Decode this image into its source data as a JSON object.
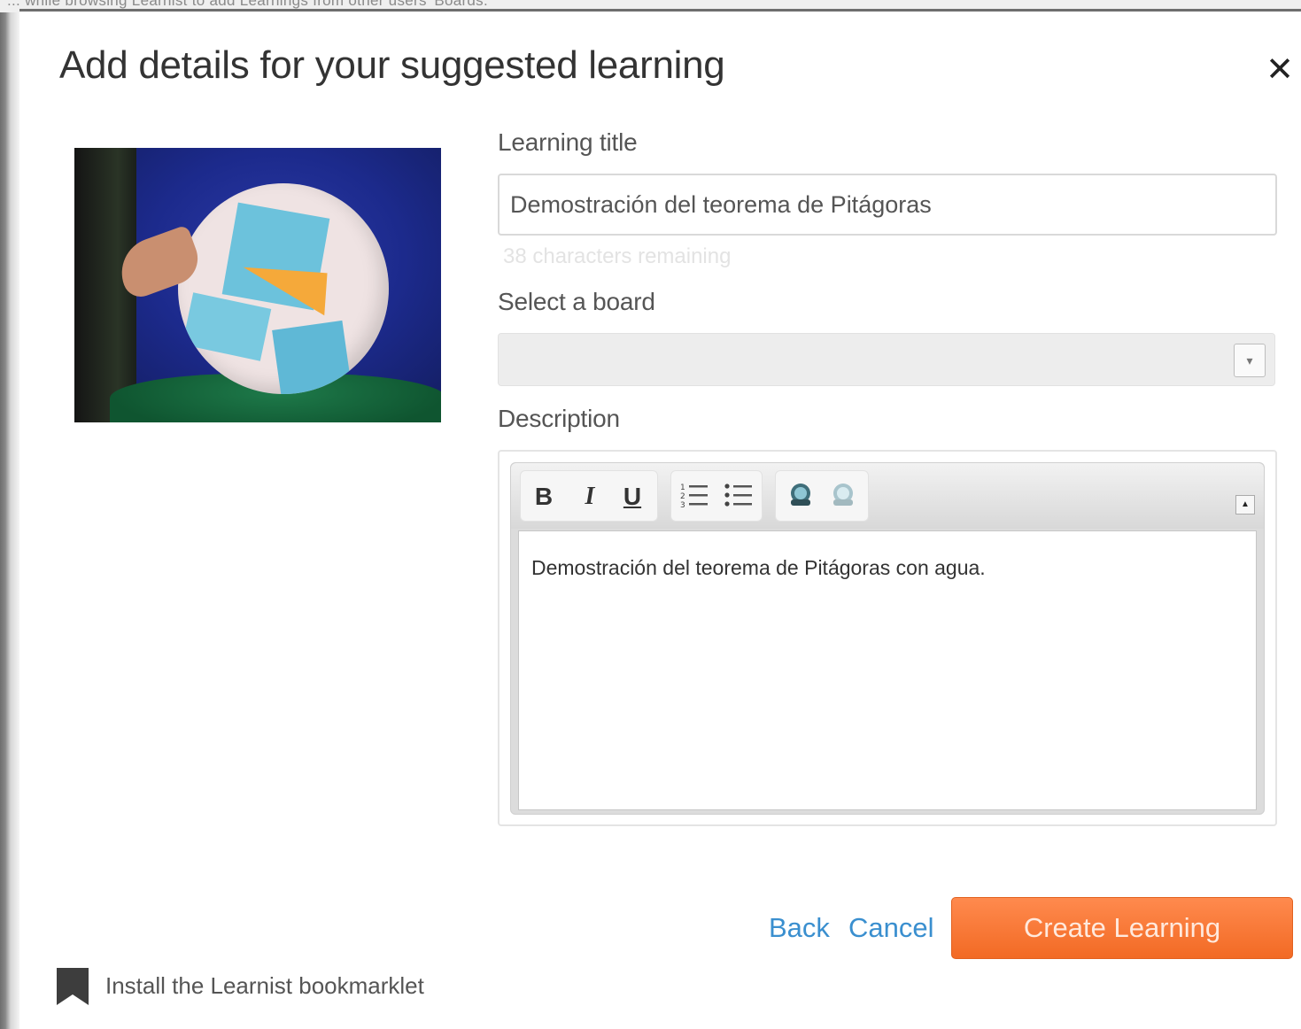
{
  "backdrop": {
    "text": "... while browsing Learnist to add Learnings from other users' Boards."
  },
  "modal": {
    "title": "Add details for your suggested learning",
    "close_symbol": "✕"
  },
  "form": {
    "title_label": "Learning title",
    "title_value": "Demostración del teorema de Pitágoras",
    "char_count": "38 characters remaining",
    "board_label": "Select a board",
    "board_value": "",
    "description_label": "Description",
    "description_text": "Demostración del teorema de Pitágoras con agua."
  },
  "toolbar": {
    "bold": "B",
    "italic": "I",
    "underline": "U",
    "icons": [
      "ordered-list-icon",
      "unordered-list-icon",
      "link-icon",
      "unlink-icon",
      "collapse-icon"
    ]
  },
  "actions": {
    "back": "Back",
    "cancel": "Cancel",
    "create": "Create Learning"
  },
  "footer": {
    "bookmarklet": "Install the Learnist bookmarklet"
  },
  "colors": {
    "accent": "#f26a24",
    "link": "#3a8fcf",
    "text": "#333333"
  }
}
